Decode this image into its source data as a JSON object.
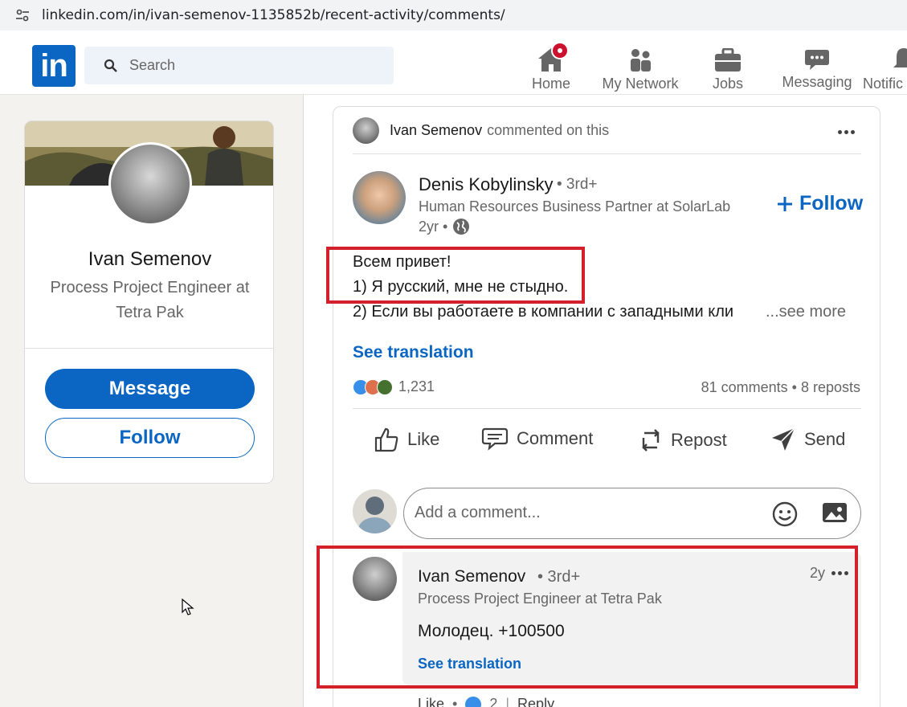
{
  "browser": {
    "url": "linkedin.com/in/ivan-semenov-1135852b/recent-activity/comments/"
  },
  "header": {
    "logo": "in",
    "search_placeholder": "Search",
    "nav": [
      {
        "label": "Home",
        "icon": "home-icon"
      },
      {
        "label": "My Network",
        "icon": "network-icon"
      },
      {
        "label": "Jobs",
        "icon": "briefcase-icon"
      },
      {
        "label": "Messaging",
        "icon": "chat-icon"
      },
      {
        "label": "Notific",
        "icon": "bell-icon"
      }
    ]
  },
  "profile": {
    "name": "Ivan Semenov",
    "title": "Process Project Engineer at Tetra Pak",
    "message_label": "Message",
    "follow_label": "Follow"
  },
  "post": {
    "context_name": "Ivan Semenov",
    "context_action": "commented on this",
    "author_name": "Denis Kobylinsky",
    "author_degree": "• 3rd+",
    "author_headline": "Human Resources Business Partner at SolarLab",
    "author_time": "2yr •",
    "follow_label": "Follow",
    "text_lines": [
      "Всем привет!",
      "1) Я русский, мне не стыдно.",
      "2) Если вы работаете в компании с западными кли"
    ],
    "see_more": "...see more",
    "see_translation": "See translation",
    "reactions_count": "1,231",
    "stats": "81 comments • 8 reposts",
    "actions": {
      "like": "Like",
      "comment": "Comment",
      "repost": "Repost",
      "send": "Send"
    },
    "comment_placeholder": "Add a comment..."
  },
  "comment": {
    "name": "Ivan Semenov",
    "degree": "• 3rd+",
    "time": "2y",
    "headline": "Process Project Engineer at Tetra Pak",
    "text": "Молодец. +100500",
    "see_translation": "See translation",
    "like_label": "Like",
    "like_count": "2",
    "reply_label": "Reply"
  },
  "colors": {
    "brand": "#0a66c2",
    "highlight_box": "#d4202a",
    "badge": "#cb112d"
  }
}
